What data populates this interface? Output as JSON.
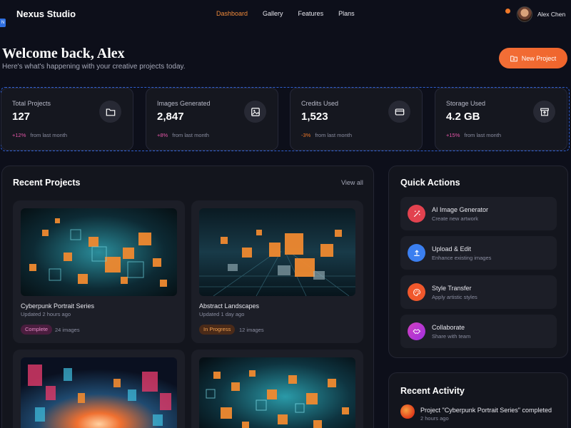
{
  "nav": {
    "badge": "N",
    "brand": "Nexus Studio",
    "items": [
      {
        "label": "Dashboard",
        "active": true
      },
      {
        "label": "Gallery"
      },
      {
        "label": "Features"
      },
      {
        "label": "Plans"
      }
    ],
    "user_name": "Alex Chen"
  },
  "header": {
    "welcome": "Welcome back, Alex",
    "subtitle": "Here's what's happening with your creative projects today.",
    "new_project": "New Project"
  },
  "stats": [
    {
      "label": "Total Projects",
      "value": "127",
      "change": "+12%",
      "change_note": "from last month",
      "icon": "folder-icon"
    },
    {
      "label": "Images Generated",
      "value": "2,847",
      "change": "+8%",
      "change_note": "from last month",
      "icon": "image-icon"
    },
    {
      "label": "Credits Used",
      "value": "1,523",
      "change": "-3%",
      "change_note": "from last month",
      "icon": "credit-card-icon"
    },
    {
      "label": "Storage Used",
      "value": "4.2 GB",
      "change": "+15%",
      "change_note": "from last month",
      "icon": "storage-icon"
    }
  ],
  "recent_projects": {
    "title": "Recent Projects",
    "view_all": "View all",
    "cards": [
      {
        "title": "Cyberpunk Portrait Series",
        "updated": "Updated 2 hours ago",
        "status": "Complete",
        "count": "24 images"
      },
      {
        "title": "Abstract Landscapes",
        "updated": "Updated 1 day ago",
        "status": "In Progress",
        "count": "12 images"
      },
      {
        "title": "",
        "updated": "",
        "status": "",
        "count": ""
      },
      {
        "title": "",
        "updated": "",
        "status": "",
        "count": ""
      }
    ]
  },
  "quick_actions": {
    "title": "Quick Actions",
    "items": [
      {
        "title": "AI Image Generator",
        "subtitle": "Create new artwork",
        "icon": "magic-wand-icon",
        "color": "#e2424f"
      },
      {
        "title": "Upload & Edit",
        "subtitle": "Enhance existing images",
        "icon": "upload-icon",
        "color": "#3b7ff0"
      },
      {
        "title": "Style Transfer",
        "subtitle": "Apply artistic styles",
        "icon": "palette-icon",
        "color": "#f0582c"
      },
      {
        "title": "Collaborate",
        "subtitle": "Share with team",
        "icon": "handshake-icon",
        "color": "#c43bd0"
      }
    ]
  },
  "recent_activity": {
    "title": "Recent Activity",
    "items": [
      {
        "text": "Project \"Cyberpunk Portrait Series\" completed",
        "time": "2 hours ago"
      }
    ]
  }
}
